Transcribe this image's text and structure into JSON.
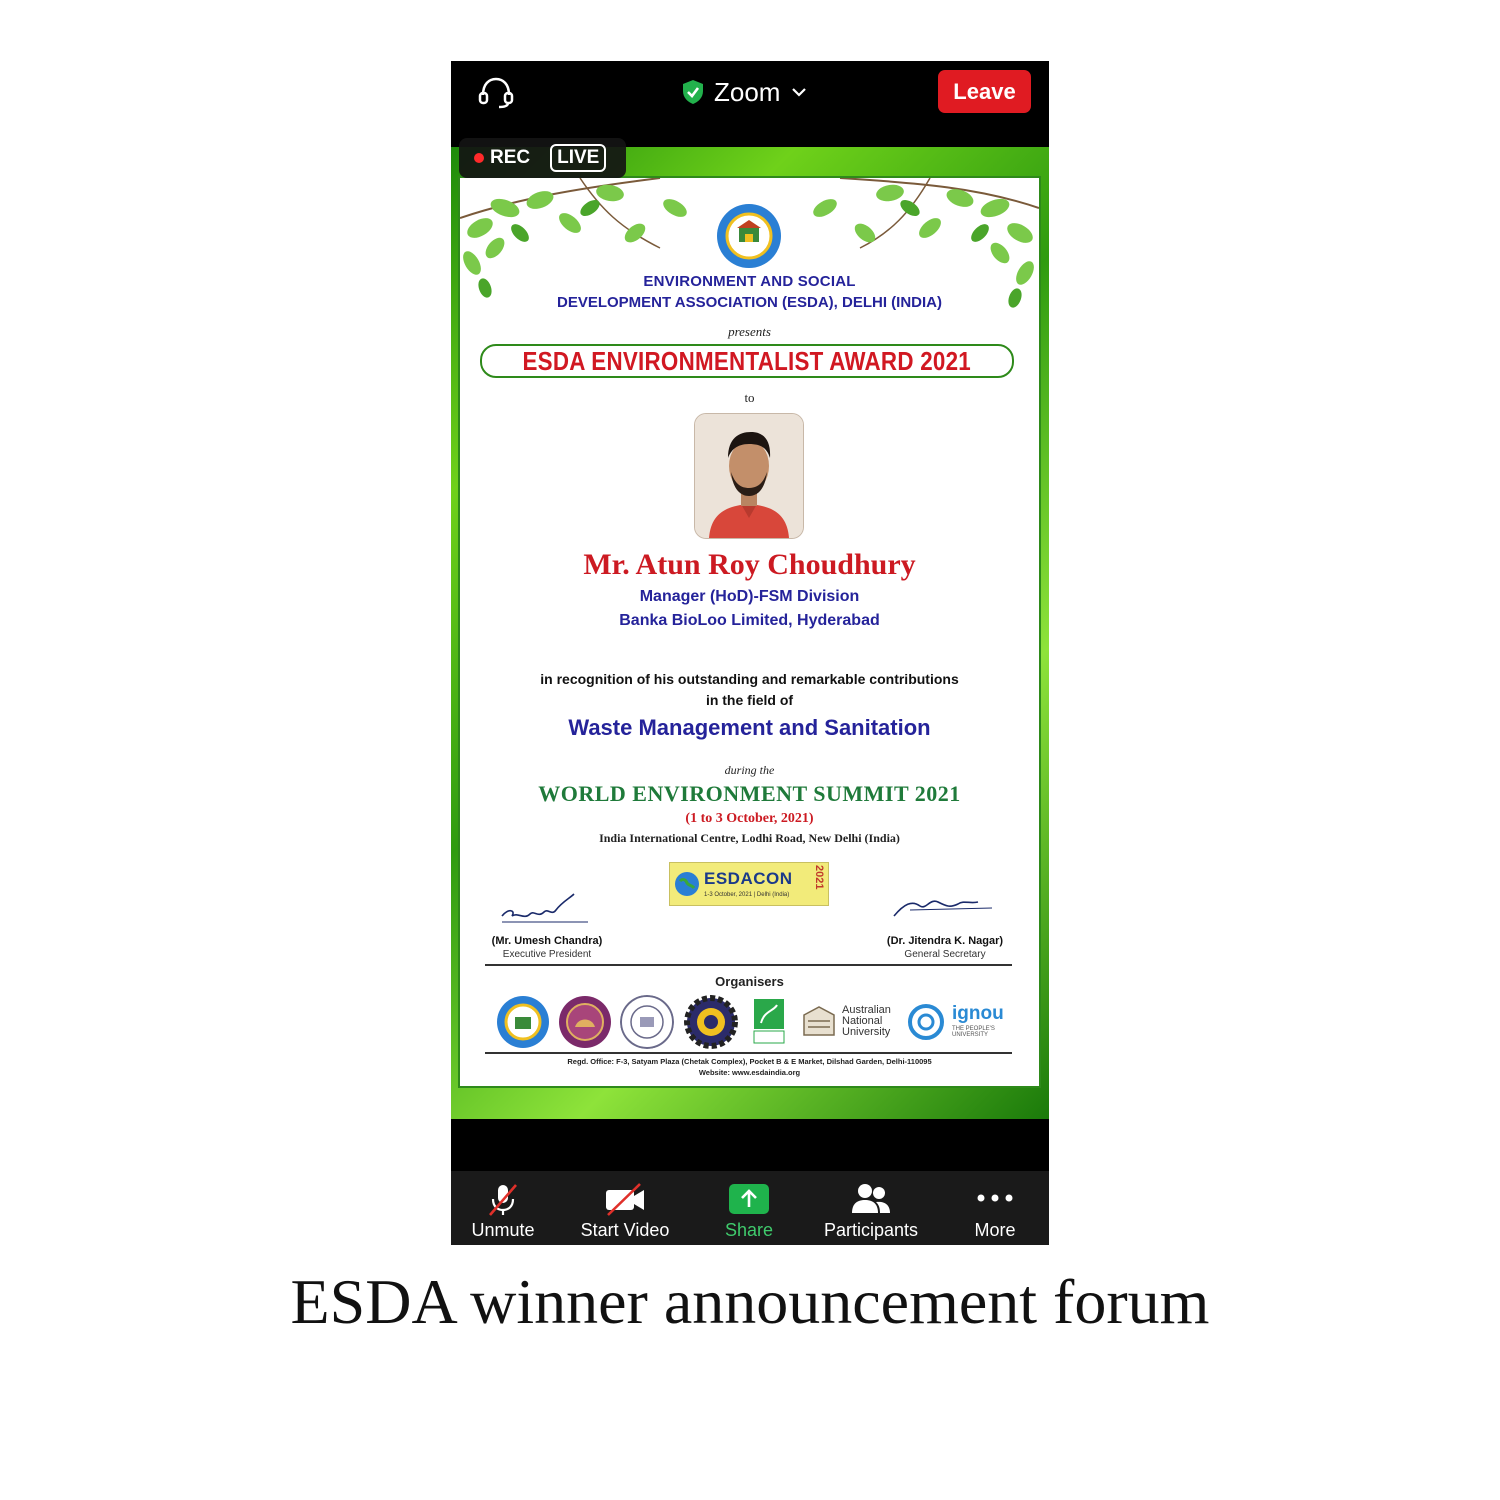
{
  "app": {
    "title": "Zoom",
    "leave_label": "Leave",
    "rec_label": "REC",
    "live_label": "LIVE"
  },
  "certificate": {
    "org_line1": "ENVIRONMENT AND SOCIAL",
    "org_line2": "DEVELOPMENT ASSOCIATION (ESDA), DELHI (INDIA)",
    "presents": "presents",
    "award_title": "ESDA ENVIRONMENTALIST AWARD 2021",
    "to": "to",
    "recipient_name": "Mr. Atun Roy Choudhury",
    "recipient_role": "Manager (HoD)-FSM Division",
    "recipient_company": "Banka BioLoo Limited, Hyderabad",
    "recognition_line1": "in recognition of his outstanding and remarkable contributions",
    "recognition_line2": "in the field of",
    "field": "Waste Management and Sanitation",
    "during": "during the",
    "summit": "WORLD ENVIRONMENT SUMMIT 2021",
    "summit_dates": "(1 to 3 October, 2021)",
    "venue": "India International Centre, Lodhi Road, New Delhi (India)",
    "esdacon_logo_text": "ESDACON",
    "esdacon_logo_sub": "1-3 October, 2021 | Delhi (India)",
    "esdacon_logo_year": "2021",
    "signatory_left_name": "(Mr. Umesh Chandra)",
    "signatory_left_title": "Executive President",
    "signatory_right_name": "(Dr. Jitendra K. Nagar)",
    "signatory_right_title": "General Secretary",
    "organisers_label": "Organisers",
    "organiser_anu": "Australian National University",
    "organiser_ignou": "ignou",
    "organiser_ignou_sub": "THE PEOPLE'S UNIVERSITY",
    "regd_office": "Regd. Office: F-3, Satyam Plaza (Chetak Complex), Pocket B & E Market, Dilshad Garden, Delhi-110095",
    "website": "Website: www.esdaindia.org"
  },
  "toolbar": {
    "unmute": "Unmute",
    "start_video": "Start Video",
    "share": "Share",
    "participants": "Participants",
    "more": "More"
  },
  "caption": "ESDA winner announcement forum",
  "colors": {
    "leave_red": "#e01b22",
    "share_green": "#3fca6c",
    "award_red": "#d11822",
    "text_navy": "#25239a",
    "summit_green": "#1f7a3a"
  }
}
